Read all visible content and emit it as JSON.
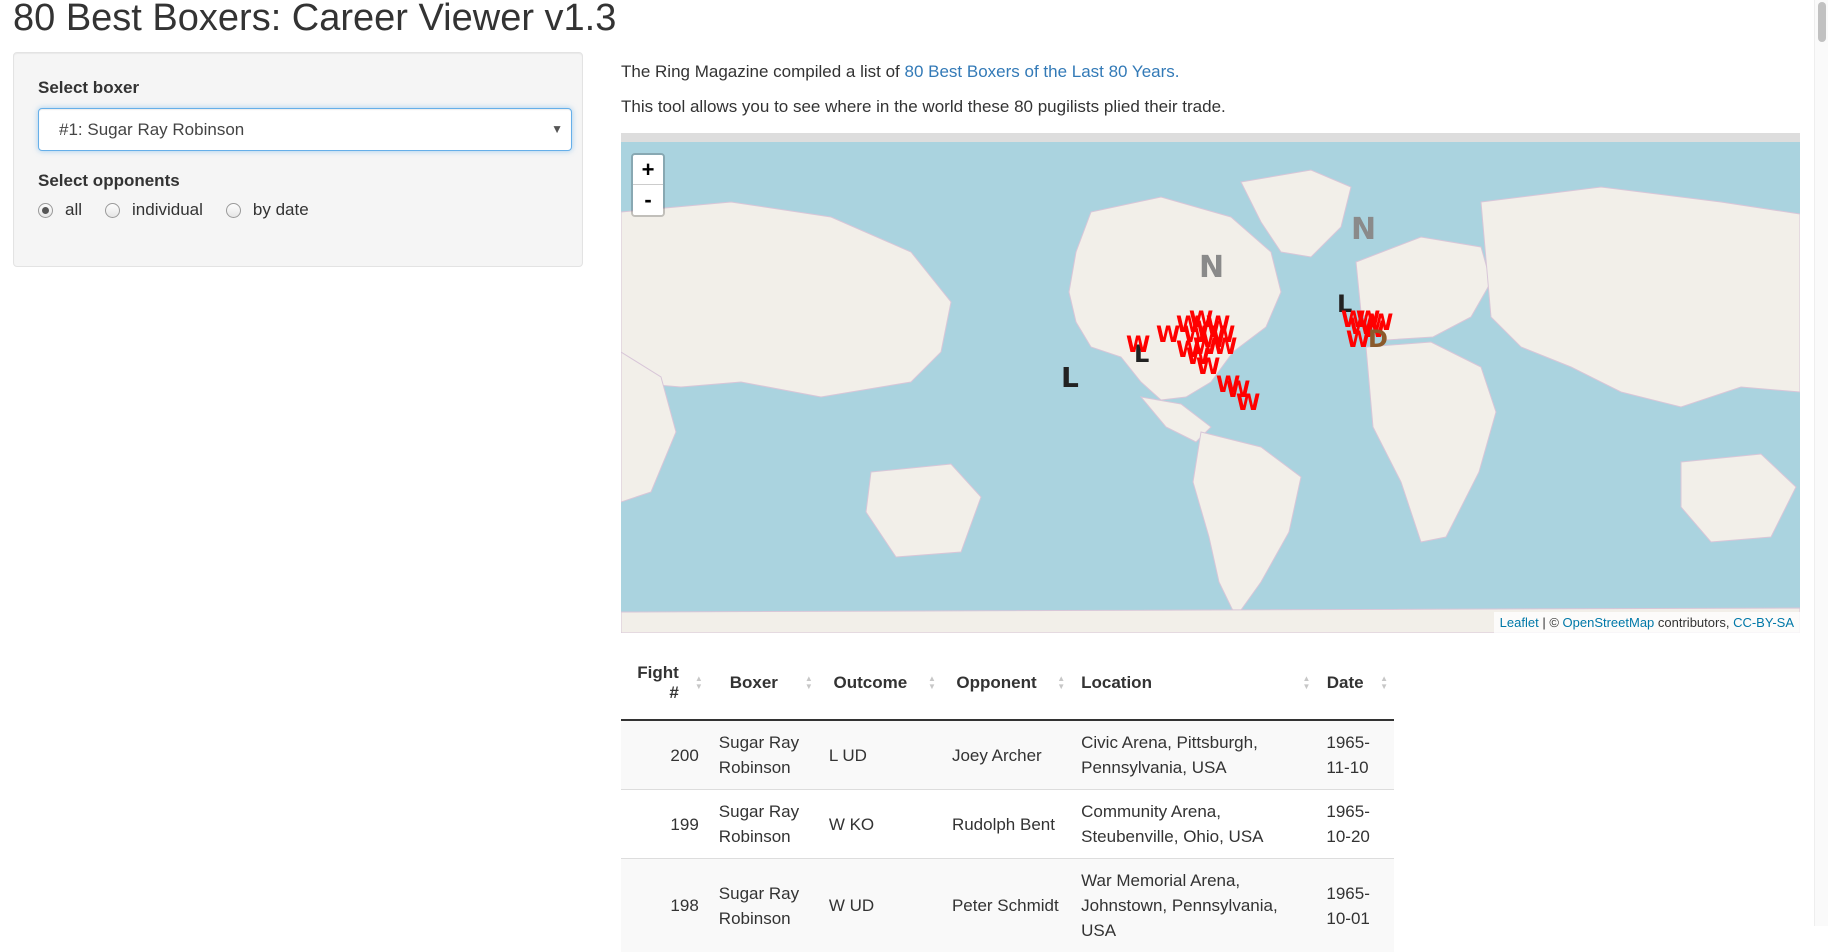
{
  "app": {
    "title": "80 Best Boxers: Career Viewer v1.3"
  },
  "sidebar": {
    "boxer_label": "Select boxer",
    "boxer_value": "#1: Sugar Ray Robinson",
    "opponents_label": "Select opponents",
    "opponent_options": [
      {
        "label": "all",
        "checked": true
      },
      {
        "label": "individual",
        "checked": false
      },
      {
        "label": "by date",
        "checked": false
      }
    ]
  },
  "intro": {
    "line1_prefix": "The Ring Magazine compiled a list of ",
    "line1_link": "80 Best Boxers of the Last 80 Years.",
    "line2": "This tool allows you to see where in the world these 80 pugilists plied their trade."
  },
  "map": {
    "zoom_in": "+",
    "zoom_out": "-",
    "attribution": {
      "leaflet": "Leaflet",
      "separator": " | © ",
      "osm": "OpenStreetMap",
      "contributors": " contributors, ",
      "license": "CC-BY-SA"
    },
    "colors": {
      "win": "#ff0000",
      "loss": "#222222",
      "nc": "#666666",
      "draw": "#8b5a2b",
      "sea": "#aad3df",
      "land": "#f2efe9"
    }
  },
  "table": {
    "columns": [
      "Fight #",
      "Boxer",
      "Outcome",
      "Opponent",
      "Location",
      "Date"
    ],
    "rows": [
      {
        "fight": "200",
        "boxer": "Sugar Ray Robinson",
        "outcome": "L UD",
        "opponent": "Joey Archer",
        "location": "Civic Arena, Pittsburgh, Pennsylvania, USA",
        "date": "1965-11-10"
      },
      {
        "fight": "199",
        "boxer": "Sugar Ray Robinson",
        "outcome": "W KO",
        "opponent": "Rudolph Bent",
        "location": "Community Arena, Steubenville, Ohio, USA",
        "date": "1965-10-20"
      },
      {
        "fight": "198",
        "boxer": "Sugar Ray Robinson",
        "outcome": "W UD",
        "opponent": "Peter Schmidt",
        "location": "War Memorial Arena, Johnstown, Pennsylvania, USA",
        "date": "1965-10-01"
      }
    ]
  }
}
